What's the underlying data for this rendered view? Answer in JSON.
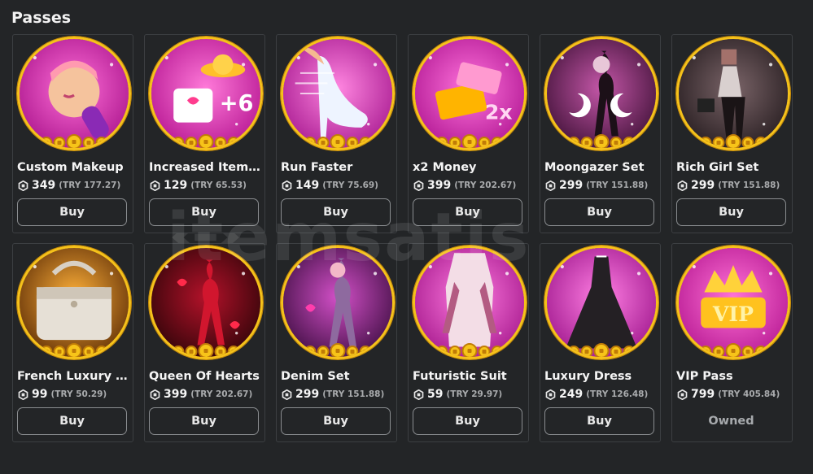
{
  "section": {
    "title": "Passes"
  },
  "watermark": "itemsatis",
  "colors": {
    "background": "#232527",
    "card_border": "#3c3f42",
    "gold": "#f6c21a",
    "button_border": "#8a8d90",
    "muted": "#a9abad"
  },
  "currency_icon": "robux-icon",
  "items": [
    {
      "name": "Custom Makeup",
      "price": "349",
      "local": "(TRY 177.27)",
      "action": "Buy",
      "art": "makeup"
    },
    {
      "name": "Increased Item Li...",
      "price": "129",
      "local": "(TRY 65.53)",
      "action": "Buy",
      "art": "items"
    },
    {
      "name": "Run Faster",
      "price": "149",
      "local": "(TRY 75.69)",
      "action": "Buy",
      "art": "heel"
    },
    {
      "name": "x2 Money",
      "price": "399",
      "local": "(TRY 202.67)",
      "action": "Buy",
      "art": "money"
    },
    {
      "name": "Moongazer Set",
      "price": "299",
      "local": "(TRY 151.88)",
      "action": "Buy",
      "art": "moon"
    },
    {
      "name": "Rich Girl Set",
      "price": "299",
      "local": "(TRY 151.88)",
      "action": "Buy",
      "art": "rich"
    },
    {
      "name": "French Luxury B...",
      "price": "99",
      "local": "(TRY 50.29)",
      "action": "Buy",
      "art": "bag"
    },
    {
      "name": "Queen Of Hearts",
      "price": "399",
      "local": "(TRY 202.67)",
      "action": "Buy",
      "art": "hearts"
    },
    {
      "name": "Denim Set",
      "price": "299",
      "local": "(TRY 151.88)",
      "action": "Buy",
      "art": "denim"
    },
    {
      "name": "Futuristic Suit",
      "price": "59",
      "local": "(TRY 29.97)",
      "action": "Buy",
      "art": "suit"
    },
    {
      "name": "Luxury Dress",
      "price": "249",
      "local": "(TRY 126.48)",
      "action": "Buy",
      "art": "dress"
    },
    {
      "name": "VIP Pass",
      "price": "799",
      "local": "(TRY 405.84)",
      "action": "Owned",
      "art": "vip"
    }
  ]
}
